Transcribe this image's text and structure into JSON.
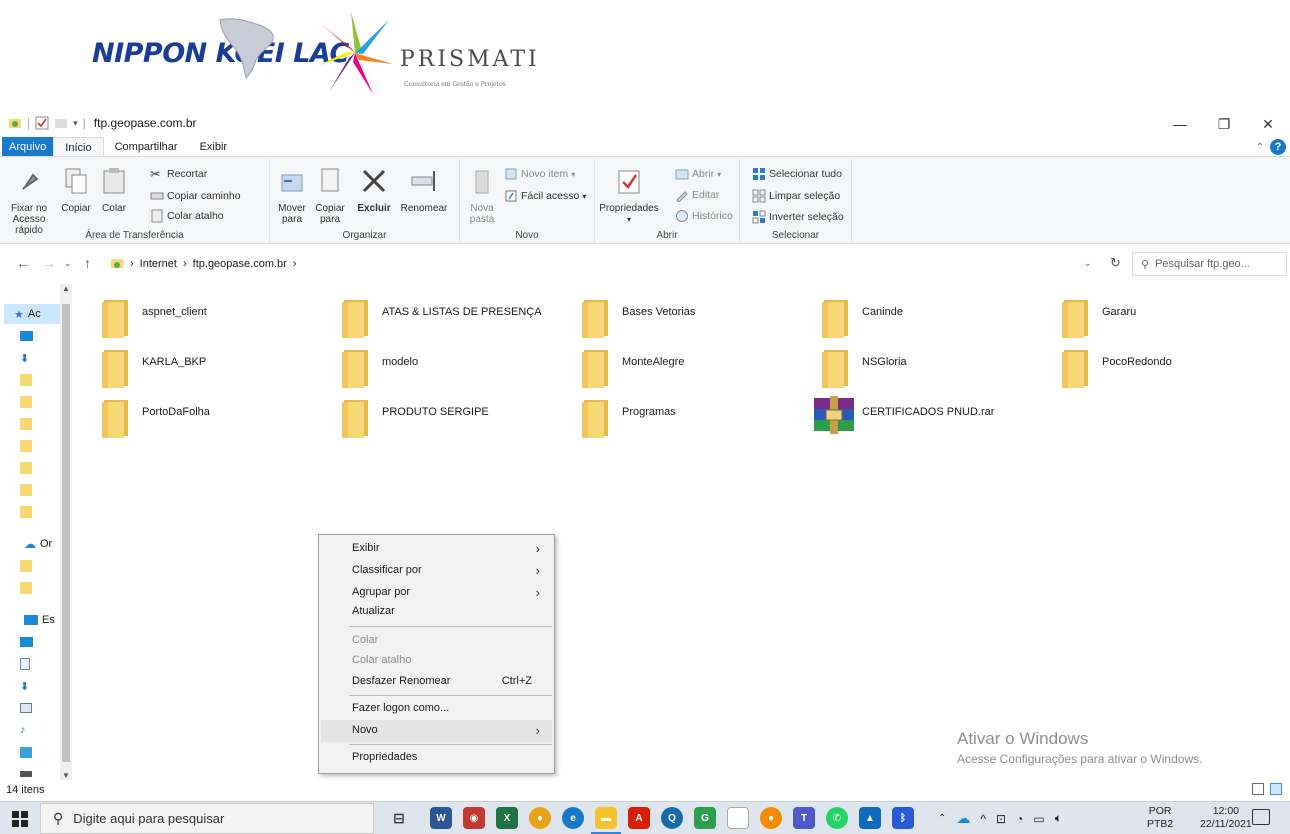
{
  "banner": {
    "logo_left": "NIPPON KOEI LAC",
    "logo_right": "PRISMATI",
    "logo_right_sub": "Consultoria em Gestão e Projetos"
  },
  "window": {
    "title": "ftp.geopase.com.br",
    "minimize": "—",
    "restore": "❐",
    "close": "✕"
  },
  "ribbon_tabs": [
    {
      "label": "Arquivo"
    },
    {
      "label": "Início"
    },
    {
      "label": "Compartilhar"
    },
    {
      "label": "Exibir"
    }
  ],
  "ribbon": {
    "clipboard": {
      "pin": "Fixar no Acesso rápido",
      "copy": "Copiar",
      "paste": "Colar",
      "cut": "Recortar",
      "copy_path": "Copiar caminho",
      "paste_shortcut": "Colar atalho",
      "label": "Área de Transferência"
    },
    "organize": {
      "move": "Mover para",
      "copy_to": "Copiar para",
      "delete": "Excluir",
      "rename": "Renomear",
      "label": "Organizar"
    },
    "new": {
      "new_folder": "Nova pasta",
      "new_item": "Novo item",
      "easy_access": "Fácil acesso",
      "label": "Novo"
    },
    "open": {
      "properties": "Propriedades",
      "open": "Abrir",
      "edit": "Editar",
      "history": "Histórico",
      "label": "Abrir"
    },
    "select": {
      "select_all": "Selecionar tudo",
      "select_none": "Limpar seleção",
      "invert": "Inverter seleção",
      "label": "Selecionar"
    }
  },
  "address": {
    "crumb1": "Internet",
    "crumb2": "ftp.geopase.com.br",
    "search_placeholder": "Pesquisar ftp.geo..."
  },
  "nav": {
    "quick_access": "Ac",
    "onedrive": "Or",
    "this_pc": "Es"
  },
  "files": [
    {
      "name": "aspnet_client",
      "type": "folder"
    },
    {
      "name": "ATAS & LISTAS DE PRESENÇA",
      "type": "folder"
    },
    {
      "name": "Bases Vetorias",
      "type": "folder"
    },
    {
      "name": "Caninde",
      "type": "folder"
    },
    {
      "name": "Gararu",
      "type": "folder"
    },
    {
      "name": "KARLA_BKP",
      "type": "folder"
    },
    {
      "name": "modelo",
      "type": "folder"
    },
    {
      "name": "MonteAlegre",
      "type": "folder"
    },
    {
      "name": "NSGloria",
      "type": "folder"
    },
    {
      "name": "PocoRedondo",
      "type": "folder"
    },
    {
      "name": "PortoDaFolha",
      "type": "folder"
    },
    {
      "name": "PRODUTO SERGIPE",
      "type": "folder"
    },
    {
      "name": "Programas",
      "type": "folder"
    },
    {
      "name": "CERTIFICADOS PNUD.rar",
      "type": "rar"
    }
  ],
  "context_menu": {
    "view": "Exibir",
    "sort": "Classificar por",
    "group": "Agrupar por",
    "refresh": "Atualizar",
    "paste": "Colar",
    "paste_shortcut": "Colar atalho",
    "undo": "Desfazer Renomear",
    "undo_shortcut": "Ctrl+Z",
    "login_as": "Fazer logon como...",
    "new": "Novo",
    "properties": "Propriedades"
  },
  "watermark": {
    "line1": "Ativar o Windows",
    "line2": "Acesse Configurações para ativar o Windows."
  },
  "status": {
    "items": "14 itens"
  },
  "taskbar": {
    "search_placeholder": "Digite aqui para pesquisar",
    "lang1": "POR",
    "lang2": "PTB2",
    "time": "12:00",
    "date": "22/11/2021"
  },
  "colors": {
    "accent": "#1979ca",
    "folder": "#f8d775",
    "selection": "#cce8ff"
  }
}
